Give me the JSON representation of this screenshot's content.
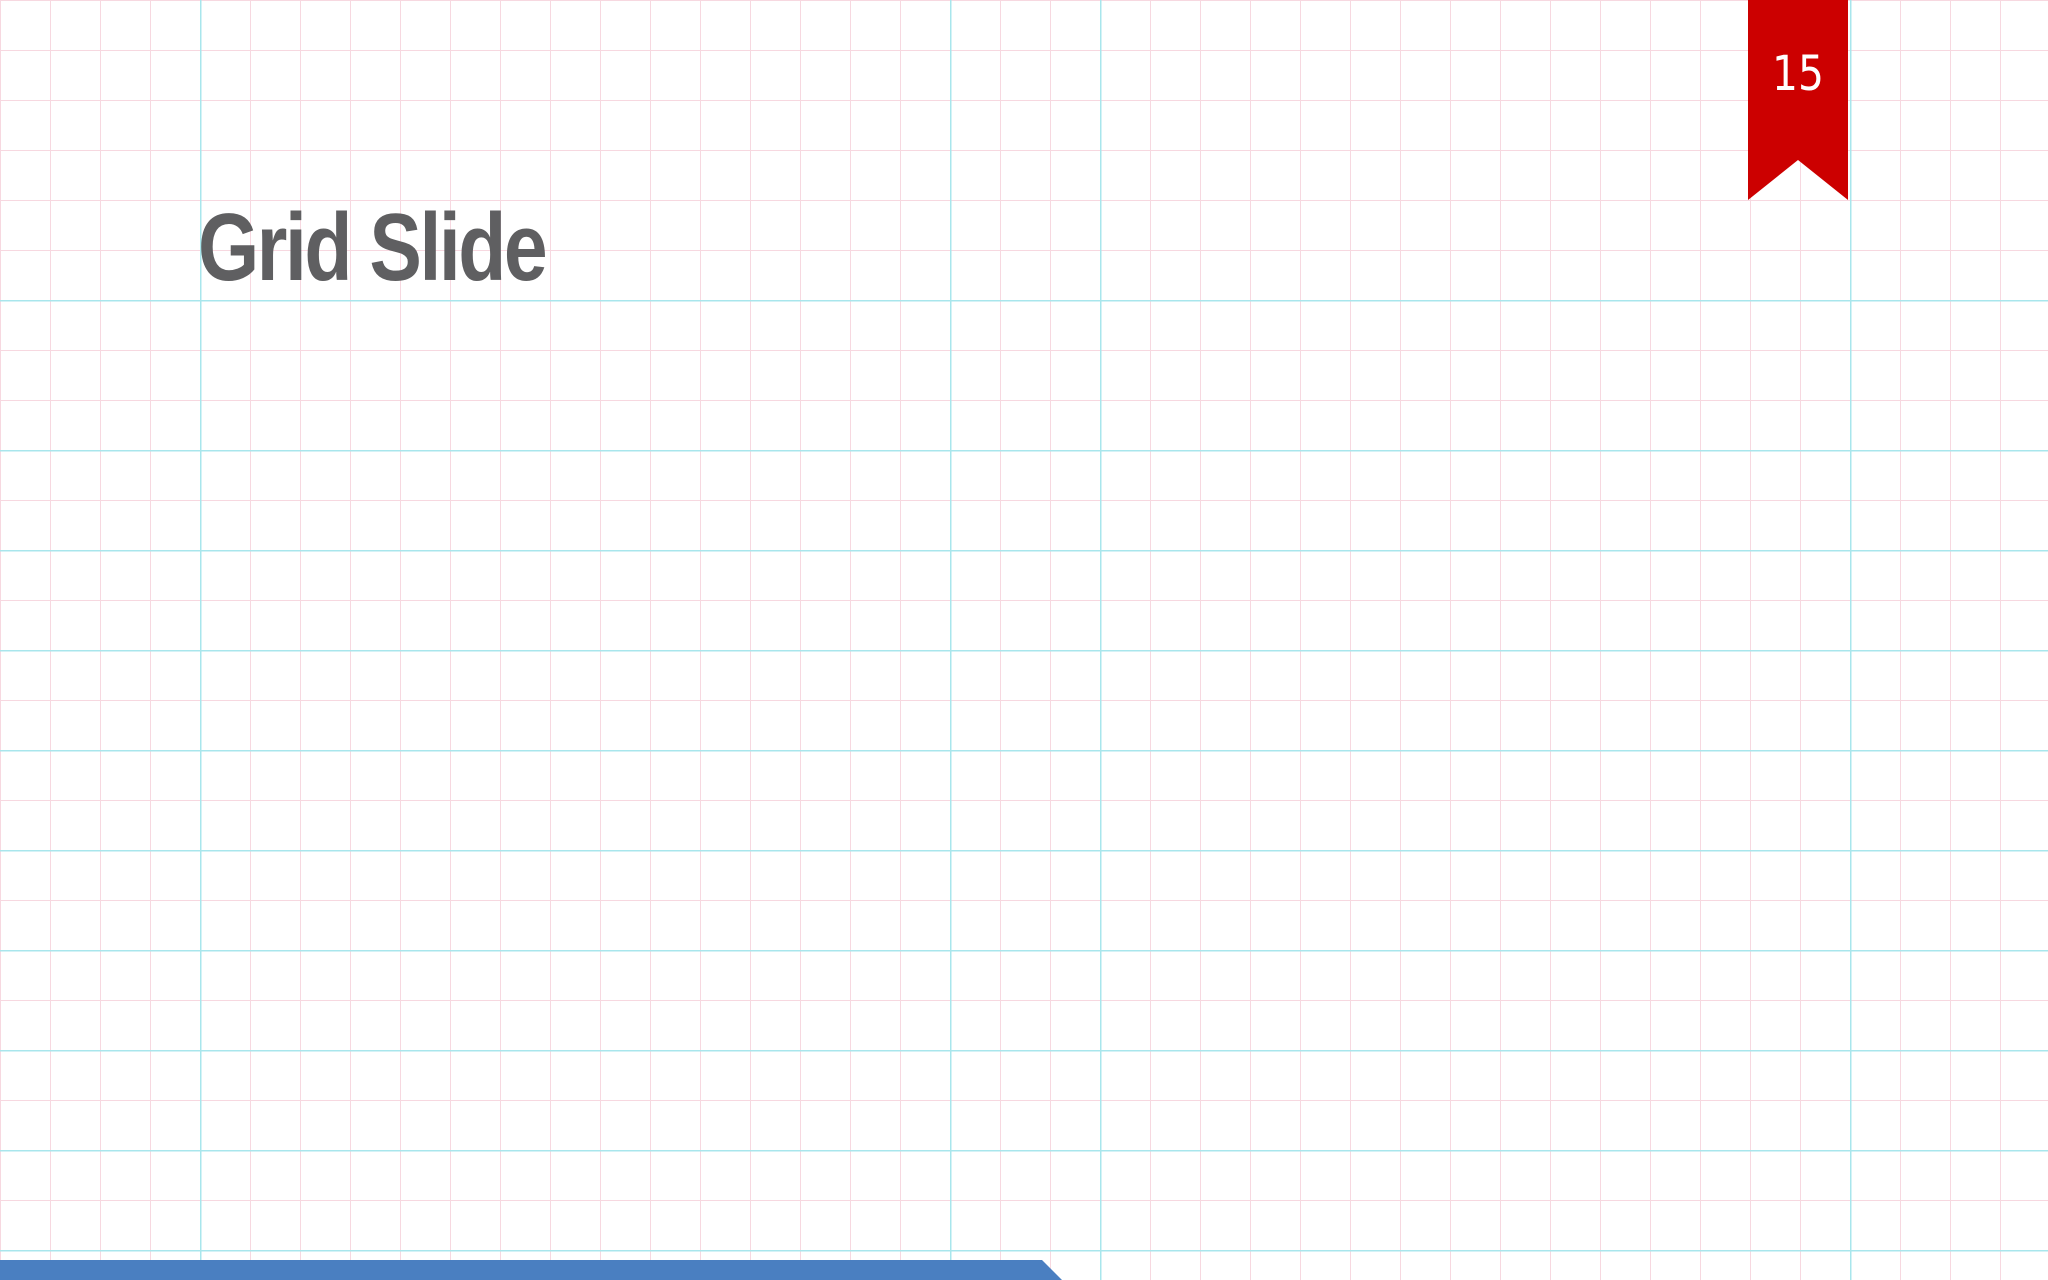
{
  "slide": {
    "title": "Grid Slide",
    "page_number": "15"
  },
  "colors": {
    "title_text": "#5f5f61",
    "ribbon": "#cc0000",
    "page_number_text": "#ffffff",
    "footer_bar": "#4a7fc1",
    "grid_minor": "#f7d8e0",
    "grid_major": "#a8e6ec",
    "background": "#ffffff"
  }
}
